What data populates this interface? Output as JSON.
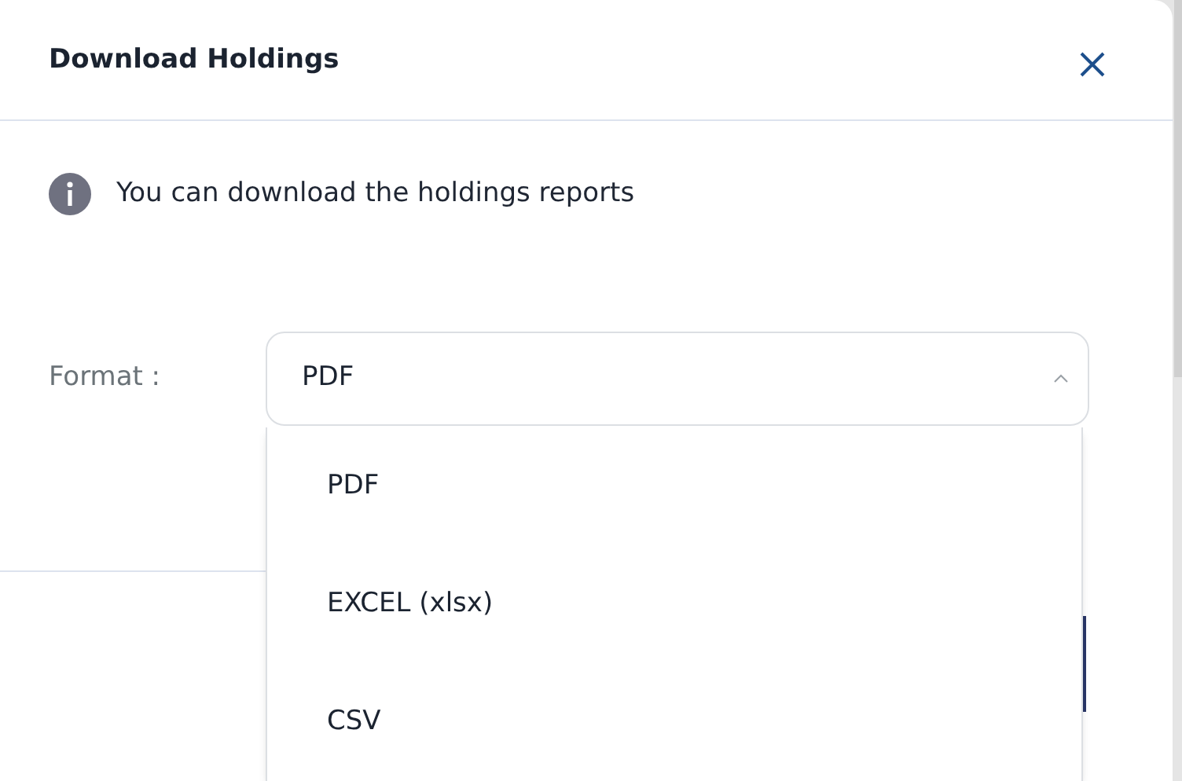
{
  "dialog": {
    "title": "Download Holdings"
  },
  "info": {
    "text": "You can download the holdings reports"
  },
  "format": {
    "label": "Format :",
    "value": "PDF",
    "expanded": true,
    "options": [
      {
        "label": "PDF"
      },
      {
        "label": "EXCEL (xlsx)"
      },
      {
        "label": "CSV"
      }
    ]
  }
}
